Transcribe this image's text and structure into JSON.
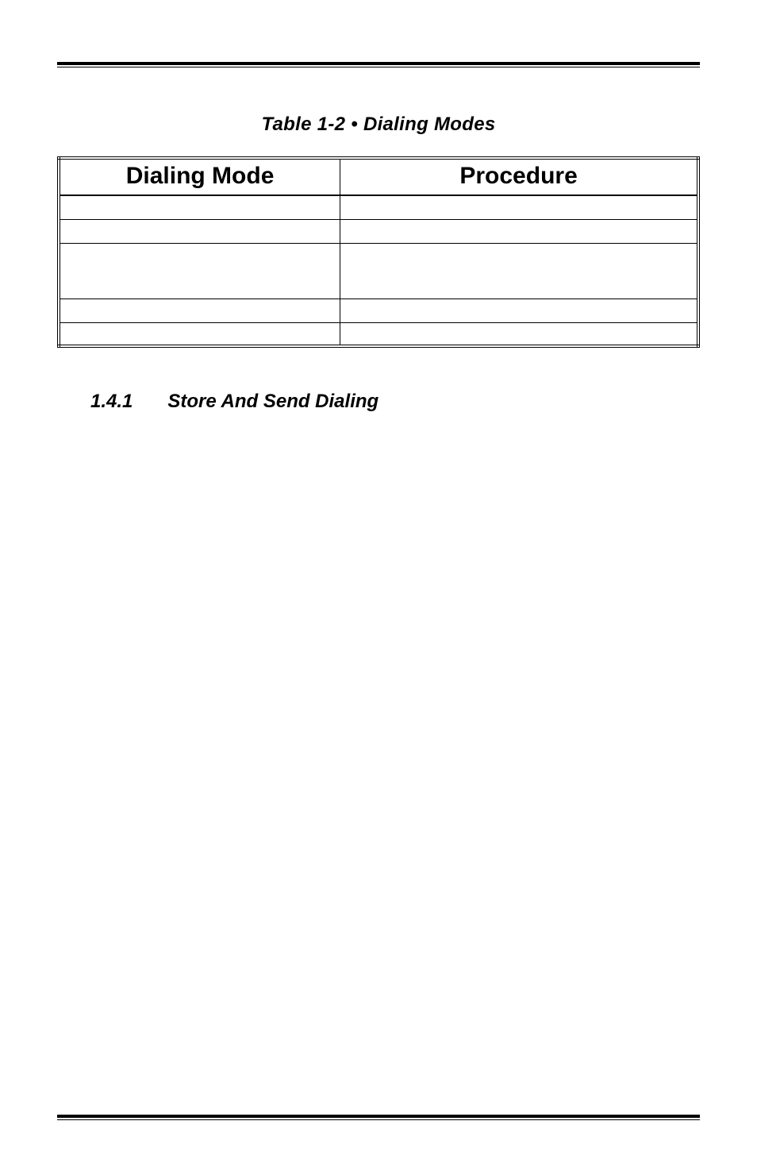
{
  "table": {
    "caption": "Table 1-2 • Dialing Modes",
    "headers": [
      "Dialing Mode",
      "Procedure"
    ],
    "rows": [
      {
        "mode": "",
        "procedure": ""
      },
      {
        "mode": "",
        "procedure": ""
      },
      {
        "mode": "",
        "procedure": "",
        "tall": true
      },
      {
        "mode": "",
        "procedure": ""
      },
      {
        "mode": "",
        "procedure": ""
      }
    ]
  },
  "section": {
    "number": "1.4.1",
    "title": "Store And Send Dialing"
  }
}
